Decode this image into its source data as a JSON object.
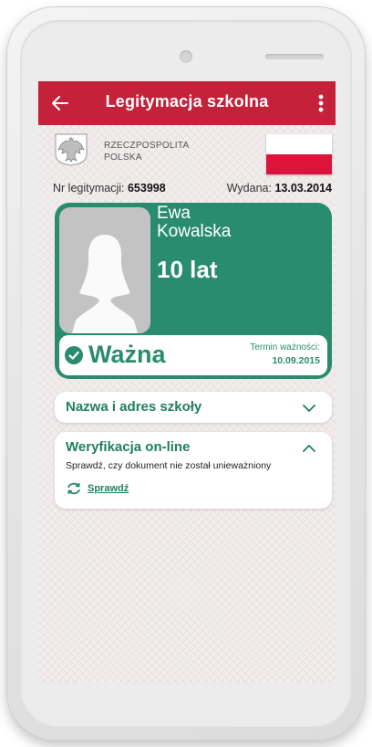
{
  "app": {
    "title": "Legitymacja szkolna"
  },
  "header": {
    "country_line1": "RZECZPOSPOLITA",
    "country_line2": "POLSKA",
    "id_number_label": "Nr legitymacji:",
    "id_number": "653998",
    "issued_label": "Wydana:",
    "issued_date": "13.03.2014"
  },
  "card": {
    "first_name": "Ewa",
    "last_name": "Kowalska",
    "age": "10 lat",
    "status": "Ważna",
    "valid_until_label": "Termin ważności:",
    "valid_until": "10.09.2015",
    "accent_color": "#2a8c6e"
  },
  "sections": {
    "school": {
      "title": "Nazwa i adres szkoły",
      "expanded": false
    },
    "verification": {
      "title": "Weryfikacja on-line",
      "description": "Sprawdź, czy dokument nie został unieważniony",
      "link_label": "Sprawdź",
      "expanded": true
    }
  },
  "colors": {
    "appbar": "#c4213a",
    "flag_white": "#ffffff",
    "flag_red": "#dc143c"
  },
  "icons": [
    "back-arrow-icon",
    "more-vert-icon",
    "eagle-emblem-icon",
    "check-circle-icon",
    "chevron-down-icon",
    "chevron-up-icon",
    "refresh-icon"
  ]
}
